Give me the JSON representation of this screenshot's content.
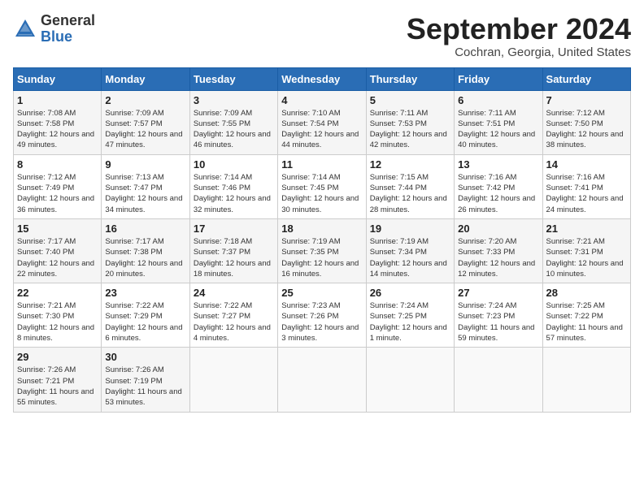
{
  "header": {
    "logo_general": "General",
    "logo_blue": "Blue",
    "month_title": "September 2024",
    "subtitle": "Cochran, Georgia, United States"
  },
  "days_of_week": [
    "Sunday",
    "Monday",
    "Tuesday",
    "Wednesday",
    "Thursday",
    "Friday",
    "Saturday"
  ],
  "weeks": [
    [
      {
        "day": "1",
        "sunrise": "7:08 AM",
        "sunset": "7:58 PM",
        "daylight": "12 hours and 49 minutes."
      },
      {
        "day": "2",
        "sunrise": "7:09 AM",
        "sunset": "7:57 PM",
        "daylight": "12 hours and 47 minutes."
      },
      {
        "day": "3",
        "sunrise": "7:09 AM",
        "sunset": "7:55 PM",
        "daylight": "12 hours and 46 minutes."
      },
      {
        "day": "4",
        "sunrise": "7:10 AM",
        "sunset": "7:54 PM",
        "daylight": "12 hours and 44 minutes."
      },
      {
        "day": "5",
        "sunrise": "7:11 AM",
        "sunset": "7:53 PM",
        "daylight": "12 hours and 42 minutes."
      },
      {
        "day": "6",
        "sunrise": "7:11 AM",
        "sunset": "7:51 PM",
        "daylight": "12 hours and 40 minutes."
      },
      {
        "day": "7",
        "sunrise": "7:12 AM",
        "sunset": "7:50 PM",
        "daylight": "12 hours and 38 minutes."
      }
    ],
    [
      {
        "day": "8",
        "sunrise": "7:12 AM",
        "sunset": "7:49 PM",
        "daylight": "12 hours and 36 minutes."
      },
      {
        "day": "9",
        "sunrise": "7:13 AM",
        "sunset": "7:47 PM",
        "daylight": "12 hours and 34 minutes."
      },
      {
        "day": "10",
        "sunrise": "7:14 AM",
        "sunset": "7:46 PM",
        "daylight": "12 hours and 32 minutes."
      },
      {
        "day": "11",
        "sunrise": "7:14 AM",
        "sunset": "7:45 PM",
        "daylight": "12 hours and 30 minutes."
      },
      {
        "day": "12",
        "sunrise": "7:15 AM",
        "sunset": "7:44 PM",
        "daylight": "12 hours and 28 minutes."
      },
      {
        "day": "13",
        "sunrise": "7:16 AM",
        "sunset": "7:42 PM",
        "daylight": "12 hours and 26 minutes."
      },
      {
        "day": "14",
        "sunrise": "7:16 AM",
        "sunset": "7:41 PM",
        "daylight": "12 hours and 24 minutes."
      }
    ],
    [
      {
        "day": "15",
        "sunrise": "7:17 AM",
        "sunset": "7:40 PM",
        "daylight": "12 hours and 22 minutes."
      },
      {
        "day": "16",
        "sunrise": "7:17 AM",
        "sunset": "7:38 PM",
        "daylight": "12 hours and 20 minutes."
      },
      {
        "day": "17",
        "sunrise": "7:18 AM",
        "sunset": "7:37 PM",
        "daylight": "12 hours and 18 minutes."
      },
      {
        "day": "18",
        "sunrise": "7:19 AM",
        "sunset": "7:35 PM",
        "daylight": "12 hours and 16 minutes."
      },
      {
        "day": "19",
        "sunrise": "7:19 AM",
        "sunset": "7:34 PM",
        "daylight": "12 hours and 14 minutes."
      },
      {
        "day": "20",
        "sunrise": "7:20 AM",
        "sunset": "7:33 PM",
        "daylight": "12 hours and 12 minutes."
      },
      {
        "day": "21",
        "sunrise": "7:21 AM",
        "sunset": "7:31 PM",
        "daylight": "12 hours and 10 minutes."
      }
    ],
    [
      {
        "day": "22",
        "sunrise": "7:21 AM",
        "sunset": "7:30 PM",
        "daylight": "12 hours and 8 minutes."
      },
      {
        "day": "23",
        "sunrise": "7:22 AM",
        "sunset": "7:29 PM",
        "daylight": "12 hours and 6 minutes."
      },
      {
        "day": "24",
        "sunrise": "7:22 AM",
        "sunset": "7:27 PM",
        "daylight": "12 hours and 4 minutes."
      },
      {
        "day": "25",
        "sunrise": "7:23 AM",
        "sunset": "7:26 PM",
        "daylight": "12 hours and 3 minutes."
      },
      {
        "day": "26",
        "sunrise": "7:24 AM",
        "sunset": "7:25 PM",
        "daylight": "12 hours and 1 minute."
      },
      {
        "day": "27",
        "sunrise": "7:24 AM",
        "sunset": "7:23 PM",
        "daylight": "11 hours and 59 minutes."
      },
      {
        "day": "28",
        "sunrise": "7:25 AM",
        "sunset": "7:22 PM",
        "daylight": "11 hours and 57 minutes."
      }
    ],
    [
      {
        "day": "29",
        "sunrise": "7:26 AM",
        "sunset": "7:21 PM",
        "daylight": "11 hours and 55 minutes."
      },
      {
        "day": "30",
        "sunrise": "7:26 AM",
        "sunset": "7:19 PM",
        "daylight": "11 hours and 53 minutes."
      },
      null,
      null,
      null,
      null,
      null
    ]
  ]
}
